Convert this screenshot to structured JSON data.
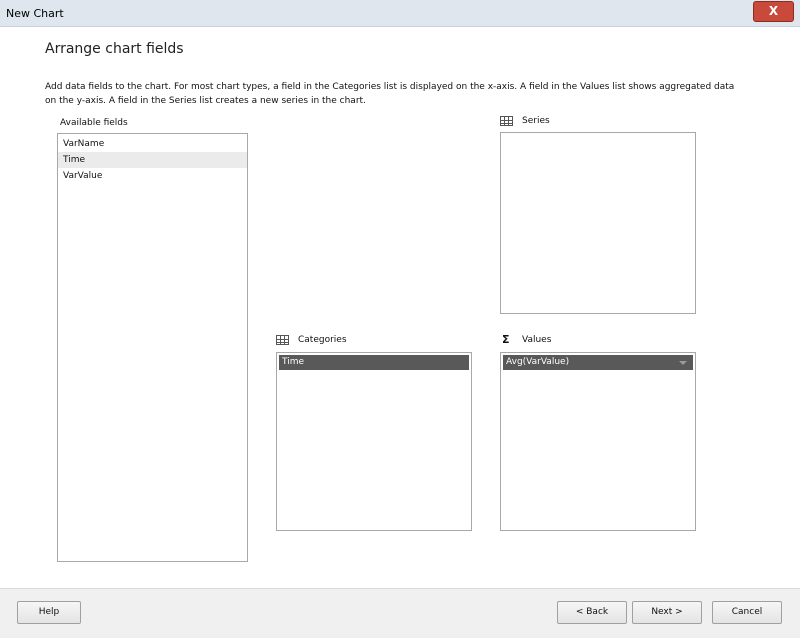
{
  "window": {
    "title": "New Chart",
    "close_symbol": "X"
  },
  "page": {
    "heading": "Arrange chart fields",
    "description": "Add data fields to the chart. For most chart types, a field in the Categories list is displayed on the x-axis. A field in the Values list shows aggregated data on the y-axis. A field in the Series list creates a new series in the chart."
  },
  "available_fields": {
    "label": "Available fields",
    "items": [
      "VarName",
      "Time",
      "VarValue"
    ]
  },
  "series": {
    "label": "Series",
    "items": []
  },
  "categories": {
    "label": "Categories",
    "items": [
      "Time"
    ]
  },
  "values": {
    "label": "Values",
    "items": [
      "Avg(VarValue)"
    ],
    "icon_symbol": "Σ"
  },
  "buttons": {
    "help": "Help",
    "back": "< Back",
    "next": "Next >",
    "cancel": "Cancel"
  }
}
